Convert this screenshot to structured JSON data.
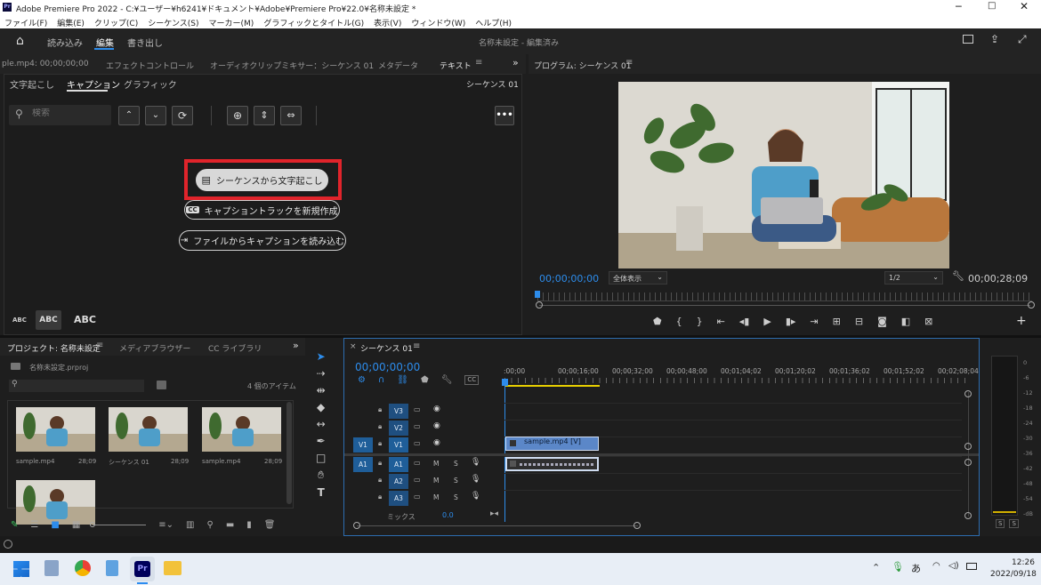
{
  "window": {
    "title": "Adobe Premiere Pro 2022 - C:¥ユーザー¥h6241¥ドキュメント¥Adobe¥Premiere Pro¥22.0¥名称未設定 *",
    "app_icon": "Pr"
  },
  "menu": [
    "ファイル(F)",
    "編集(E)",
    "クリップ(C)",
    "シーケンス(S)",
    "マーカー(M)",
    "グラフィックとタイトル(G)",
    "表示(V)",
    "ウィンドウ(W)",
    "ヘルプ(H)"
  ],
  "workspace": {
    "tabs": [
      "読み込み",
      "編集",
      "書き出し"
    ],
    "active": "編集",
    "status": "名称未設定 - 編集済み"
  },
  "text_panel": {
    "tabs": [
      "ple.mp4: 00;00;00;00",
      "エフェクトコントロール",
      "オーディオクリップミキサー：シーケンス 01",
      "メタデータ",
      "テキスト"
    ],
    "subtabs": [
      "文字起こし",
      "キャプション",
      "グラフィック"
    ],
    "active_subtab": "キャプション",
    "sequence": "シーケンス 01",
    "search_placeholder": "検索",
    "btn_transcribe": "シーケンスから文字起こし",
    "btn_new_caption": "キャプショントラックを新規作成",
    "btn_import_caption": "ファイルからキャプションを読み込む",
    "text_sizes": [
      "ABC",
      "ABC",
      "ABC"
    ],
    "cc_badge": "CC"
  },
  "program_monitor": {
    "title": "プログラム: シーケンス 01",
    "timecode": "00;00;00;00",
    "fit": "全体表示",
    "resolution": "1/2",
    "duration": "00;00;28;09",
    "plus": "+"
  },
  "project_panel": {
    "tabs": [
      "プロジェクト: 名称未設定",
      "メディアブラウザー",
      "CC ライブラリ"
    ],
    "file": "名称未設定.prproj",
    "count": "4 個のアイテム",
    "items": [
      {
        "name": "sample.mp4",
        "dur": "28;09"
      },
      {
        "name": "シーケンス 01",
        "dur": "28;09"
      },
      {
        "name": "sample.mp4",
        "dur": "28;09"
      },
      {
        "name": "",
        "dur": ""
      }
    ]
  },
  "timeline": {
    "title": "シーケンス 01",
    "close": "×",
    "timecode": "00;00;00;00",
    "ruler": [
      ":00;00",
      "00;00;16;00",
      "00;00;32;00",
      "00;00;48;00",
      "00;01;04;02",
      "00;01;20;02",
      "00;01;36;02",
      "00;01;52;02",
      "00;02;08;04"
    ],
    "video_tracks": [
      {
        "src": "",
        "name": "V3"
      },
      {
        "src": "",
        "name": "V2"
      },
      {
        "src": "V1",
        "name": "V1"
      }
    ],
    "audio_tracks": [
      {
        "src": "A1",
        "name": "A1"
      },
      {
        "src": "",
        "name": "A2"
      },
      {
        "src": "",
        "name": "A3"
      }
    ],
    "mix_label": "ミックス",
    "mix_value": "0.0",
    "clip_video": "sample.mp4 [V]",
    "m": "M",
    "s": "S"
  },
  "meter": {
    "scale": [
      "0",
      "-6",
      "-12",
      "-18",
      "-24",
      "-30",
      "-36",
      "-42",
      "-48",
      "-54",
      "-dB"
    ],
    "solo": [
      "S",
      "S"
    ]
  },
  "taskbar": {
    "ime": "あ",
    "time": "12:26",
    "date": "2022/09/18"
  },
  "colors": {
    "accent": "#2d8ceb",
    "highlight": "#e0242b",
    "clip_video": "#5b87c8",
    "panel_bg": "#232323"
  }
}
